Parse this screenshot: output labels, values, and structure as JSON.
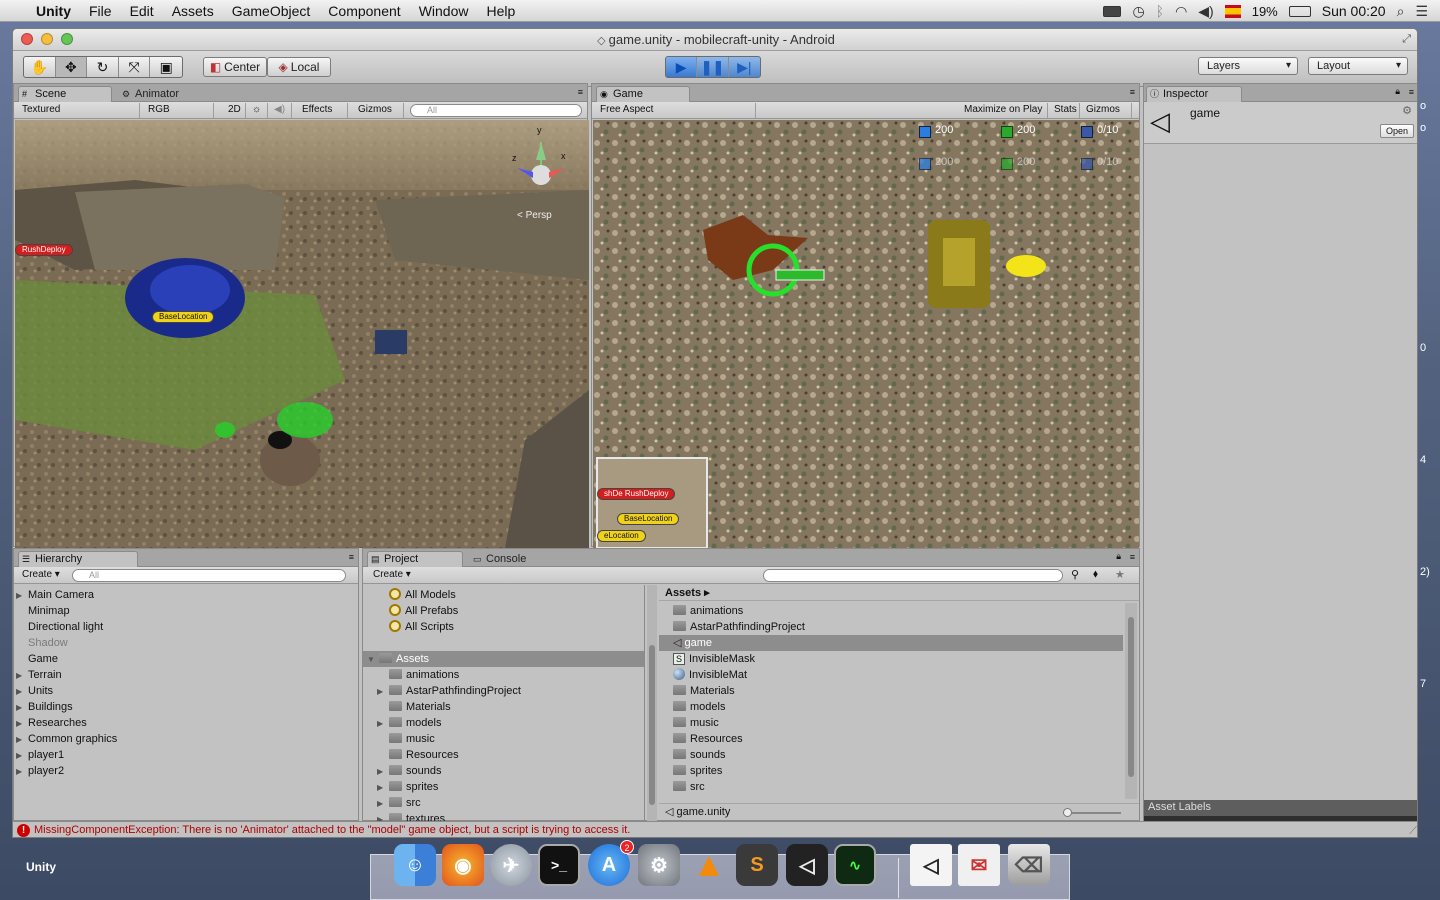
{
  "menubar": {
    "apple": "",
    "app": "Unity",
    "items": [
      "File",
      "Edit",
      "Assets",
      "GameObject",
      "Component",
      "Window",
      "Help"
    ],
    "battery": "19%",
    "clock": "Sun 00:20"
  },
  "window": {
    "title": "game.unity - mobilecraft-unity - Android"
  },
  "toolbar": {
    "pivot": "Center",
    "space": "Local",
    "layers": "Layers",
    "layout": "Layout"
  },
  "scene": {
    "tabs": [
      "Scene",
      "Animator"
    ],
    "render_mode": "Textured",
    "color_mode": "RGB",
    "twod": "2D",
    "effects": "Effects",
    "gizmos": "Gizmos",
    "search_placeholder": "All",
    "persp": "< Persp",
    "axis_y": "y",
    "axis_x": "x",
    "axis_z": "z",
    "label_rush": "RushDeploy",
    "label_base": "BaseLocation"
  },
  "game": {
    "tab": "Game",
    "aspect": "Free Aspect",
    "maximize": "Maximize on Play",
    "stats": "Stats",
    "gizmos": "Gizmos",
    "hud_rows": [
      {
        "a": "200",
        "b": "200",
        "c": "0/10"
      },
      {
        "a": "200",
        "b": "200",
        "c": "0/10"
      }
    ],
    "minimap_labels": [
      "shDe RushDeploy",
      "BaseLocation",
      "eLocation"
    ]
  },
  "inspector": {
    "tab": "Inspector",
    "object": "game",
    "open": "Open",
    "asset_labels": "Asset Labels"
  },
  "hierarchy": {
    "tab": "Hierarchy",
    "create": "Create",
    "search_placeholder": "All",
    "items": [
      {
        "label": "Main Camera",
        "expand": true,
        "dim": false
      },
      {
        "label": "Minimap",
        "expand": false,
        "dim": false
      },
      {
        "label": "Directional light",
        "expand": false,
        "dim": false
      },
      {
        "label": "Shadow",
        "expand": false,
        "dim": true
      },
      {
        "label": "Game",
        "expand": false,
        "dim": false
      },
      {
        "label": "Terrain",
        "expand": true,
        "dim": false
      },
      {
        "label": "Units",
        "expand": true,
        "dim": false
      },
      {
        "label": "Buildings",
        "expand": true,
        "dim": false
      },
      {
        "label": "Researches",
        "expand": true,
        "dim": false
      },
      {
        "label": "Common graphics",
        "expand": true,
        "dim": false
      },
      {
        "label": "player1",
        "expand": true,
        "dim": false
      },
      {
        "label": "player2",
        "expand": true,
        "dim": false
      }
    ]
  },
  "project": {
    "tabs": [
      "Project",
      "Console"
    ],
    "create": "Create",
    "favorites": [
      "All Models",
      "All Prefabs",
      "All Scripts"
    ],
    "tree_root": "Assets",
    "tree": [
      {
        "label": "animations",
        "expand": false
      },
      {
        "label": "AstarPathfindingProject",
        "expand": true
      },
      {
        "label": "Materials",
        "expand": false
      },
      {
        "label": "models",
        "expand": true
      },
      {
        "label": "music",
        "expand": false
      },
      {
        "label": "Resources",
        "expand": false
      },
      {
        "label": "sounds",
        "expand": true
      },
      {
        "label": "sprites",
        "expand": true
      },
      {
        "label": "src",
        "expand": true
      },
      {
        "label": "textures",
        "expand": true
      }
    ],
    "breadcrumb": "Assets",
    "assets": [
      {
        "label": "animations",
        "kind": "folder"
      },
      {
        "label": "AstarPathfindingProject",
        "kind": "folder"
      },
      {
        "label": "game",
        "kind": "unity",
        "selected": true
      },
      {
        "label": "InvisibleMask",
        "kind": "shader"
      },
      {
        "label": "InvisibleMat",
        "kind": "material"
      },
      {
        "label": "Materials",
        "kind": "folder"
      },
      {
        "label": "models",
        "kind": "folder"
      },
      {
        "label": "music",
        "kind": "folder"
      },
      {
        "label": "Resources",
        "kind": "folder"
      },
      {
        "label": "sounds",
        "kind": "folder"
      },
      {
        "label": "sprites",
        "kind": "folder"
      },
      {
        "label": "src",
        "kind": "folder"
      }
    ],
    "footer_file": "game.unity",
    "shader_letter": "S"
  },
  "status": {
    "message": "MissingComponentException: There is no 'Animator' attached to the \"model\" game object, but a script is trying to access it."
  },
  "desktop": {
    "unity_label": "Unity",
    "edge_digits": [
      "o",
      "o",
      "0",
      "4",
      "2)",
      "7"
    ]
  },
  "dock": {
    "badge": "2",
    "colors": {
      "accent": "#2f6bd6"
    }
  }
}
